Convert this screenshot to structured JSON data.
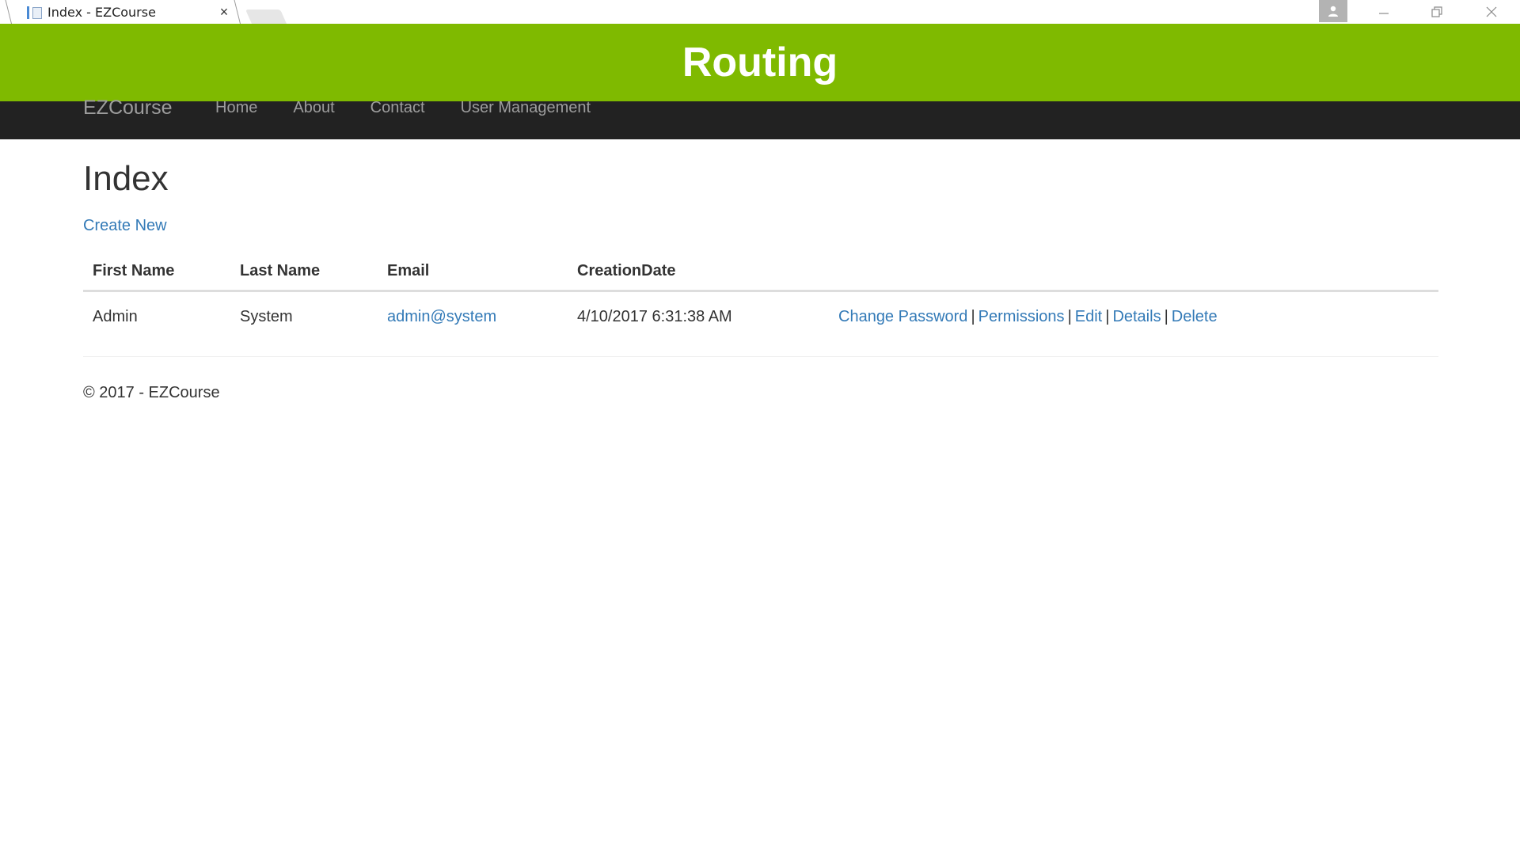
{
  "browser": {
    "tab_title": "Index - EZCourse",
    "tab_close": "×"
  },
  "banner": {
    "title": "Routing",
    "color": "#7fba00"
  },
  "navbar": {
    "brand": "EZCourse",
    "links": [
      "Home",
      "About",
      "Contact",
      "User Management"
    ]
  },
  "page": {
    "title": "Index",
    "create_link": "Create New"
  },
  "table": {
    "headers": [
      "First Name",
      "Last Name",
      "Email",
      "CreationDate"
    ],
    "rows": [
      {
        "first_name": "Admin",
        "last_name": "System",
        "email": "admin@system",
        "creation_date": "4/10/2017 6:31:38 AM",
        "actions": [
          "Change Password",
          "Permissions",
          "Edit",
          "Details",
          "Delete"
        ]
      }
    ],
    "separator": "|"
  },
  "footer": {
    "text": "© 2017 - EZCourse"
  },
  "colors": {
    "navbar_bg": "#222222",
    "link": "#337ab7"
  }
}
